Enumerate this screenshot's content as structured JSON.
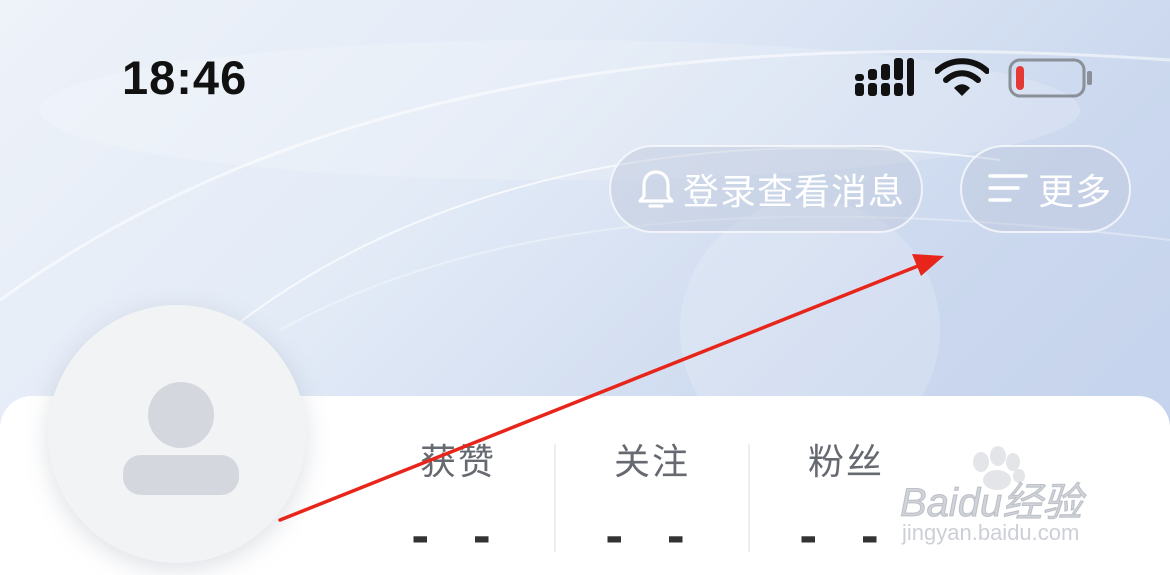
{
  "status_bar": {
    "time": "18:46",
    "signal_icon": "signal-bars-icon",
    "wifi_icon": "wifi-icon",
    "battery_icon": "battery-low-icon",
    "battery_level_color": "#e53935"
  },
  "header": {
    "messages_button": {
      "icon": "bell-icon",
      "label": "登录查看消息"
    },
    "more_button": {
      "icon": "menu-lines-icon",
      "label": "更多"
    }
  },
  "profile": {
    "avatar_icon": "default-user-icon",
    "stats": [
      {
        "label": "获赞",
        "value": "- -"
      },
      {
        "label": "关注",
        "value": "- -"
      },
      {
        "label": "粉丝",
        "value": "- -"
      }
    ]
  },
  "annotation": {
    "arrow_color": "#e8251b"
  },
  "watermark": {
    "text": "Baidu经验",
    "url": "jingyan.baidu.com"
  }
}
